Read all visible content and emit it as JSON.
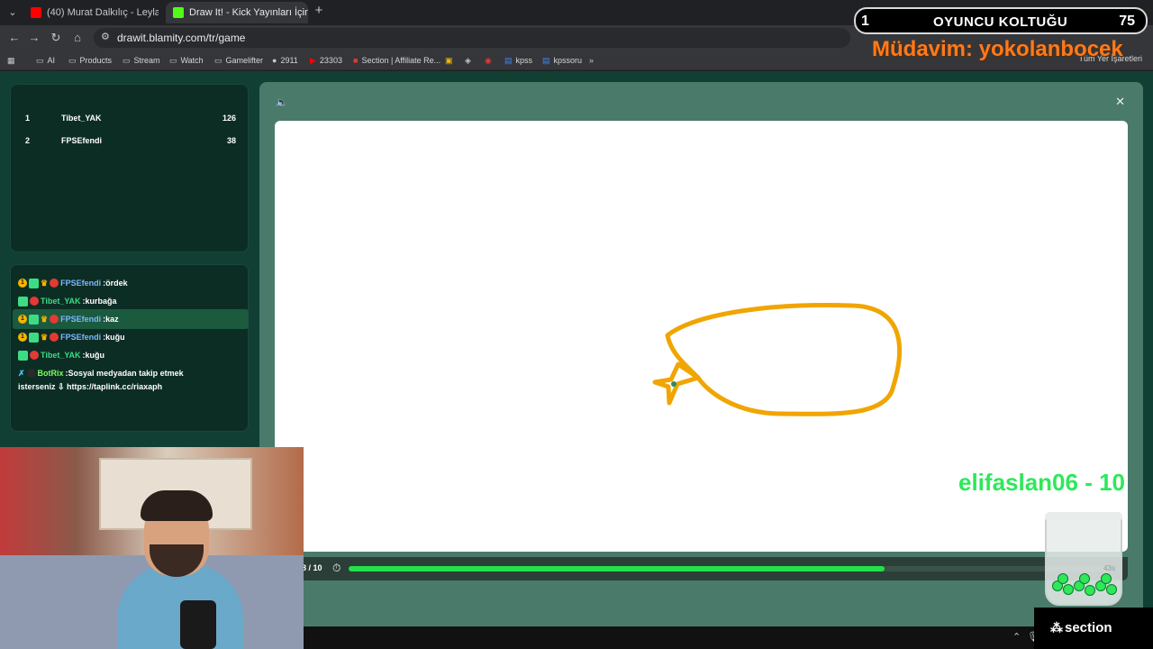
{
  "browser": {
    "tabs": [
      {
        "label": "(40) Murat Dalkılıç - Leyla",
        "favicon_color": "#ff0000",
        "active": false
      },
      {
        "label": "Draw It! - Kick Yayınları İçin",
        "favicon_color": "#53fc18",
        "active": true
      }
    ],
    "url": "drawit.blamity.com/tr/game",
    "bookmarks": [
      "AI",
      "Products",
      "Stream",
      "Watch",
      "Gamelifter",
      "2911",
      "23303",
      "Section | Affiliate Re...",
      "kpss",
      "kpssoru"
    ],
    "bookmarks_right": "Tüm Yer İşaretleri"
  },
  "leaderboard": [
    {
      "rank": "1",
      "name": "Tibet_YAK",
      "score": "126"
    },
    {
      "rank": "2",
      "name": "FPSEfendi",
      "score": "38"
    }
  ],
  "chat": [
    {
      "user": "FPSEfendi",
      "message": ":ördek",
      "badges": [
        "one",
        "sub",
        "crown",
        "red"
      ],
      "highlight": false
    },
    {
      "user": "Tibet_YAK",
      "message": ":kurbağa",
      "badges": [
        "sub",
        "red"
      ],
      "highlight": false
    },
    {
      "user": "FPSEfendi",
      "message": ":kaz",
      "badges": [
        "one",
        "sub",
        "crown",
        "red"
      ],
      "highlight": true
    },
    {
      "user": "FPSEfendi",
      "message": ":kuğu",
      "badges": [
        "one",
        "sub",
        "crown",
        "red"
      ],
      "highlight": false
    },
    {
      "user": "Tibet_YAK",
      "message": ":kuğu",
      "badges": [
        "sub",
        "red"
      ],
      "highlight": false
    }
  ],
  "bot_message": {
    "user": "BotRix",
    "message": ":Sosyal medyadan takip etmek",
    "message_cont": "isterseniz ⇩ https://taplink.cc/riaxaph"
  },
  "game": {
    "round": "8 / 10",
    "timer_progress": 0.7,
    "stroke_color": "#f0a500"
  },
  "overlay": {
    "seat_rank": "1",
    "seat_title": "OYUNCU KOLTUĞU",
    "seat_points": "75",
    "regular": "Müdavim: yokolanbocek",
    "donor": "elifaslan06 - 10",
    "jar_time": "43s",
    "sponsor": "section"
  }
}
